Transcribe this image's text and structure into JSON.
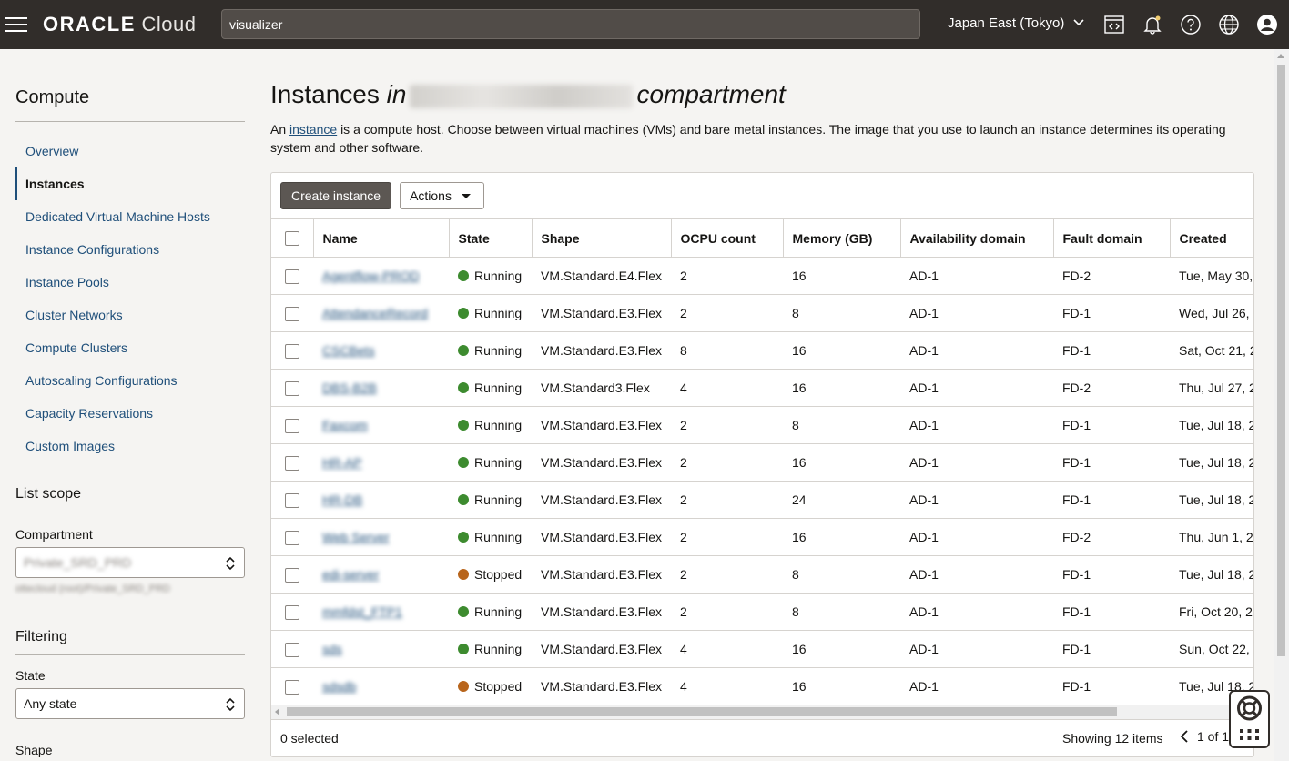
{
  "topbar": {
    "brand": "ORACLE",
    "product": "Cloud",
    "search_value": "visualizer",
    "region": "Japan East (Tokyo)",
    "icons": [
      "menu-icon",
      "code-editor-icon",
      "bell-icon",
      "help-icon",
      "globe-icon",
      "user-icon"
    ]
  },
  "sidebar": {
    "title": "Compute",
    "items": [
      {
        "label": "Overview",
        "active": false
      },
      {
        "label": "Instances",
        "active": true
      },
      {
        "label": "Dedicated Virtual Machine Hosts",
        "active": false
      },
      {
        "label": "Instance Configurations",
        "active": false
      },
      {
        "label": "Instance Pools",
        "active": false
      },
      {
        "label": "Cluster Networks",
        "active": false
      },
      {
        "label": "Compute Clusters",
        "active": false
      },
      {
        "label": "Autoscaling Configurations",
        "active": false
      },
      {
        "label": "Capacity Reservations",
        "active": false
      },
      {
        "label": "Custom Images",
        "active": false
      }
    ],
    "list_scope": {
      "title": "List scope",
      "compartment_label": "Compartment",
      "compartment_value": "Private_SRD_PRD",
      "compartment_path": "ottecloud (root)/Private_SRD_PRD"
    },
    "filtering": {
      "title": "Filtering",
      "state_label": "State",
      "state_value": "Any state",
      "shape_label": "Shape"
    }
  },
  "main": {
    "title": "Instances",
    "title_in": "in",
    "title_compartment": "compartment",
    "desc_prefix": "An",
    "desc_link": "instance",
    "desc_rest": "is a compute host. Choose between virtual machines (VMs) and bare metal instances. The image that you use to launch an instance determines its operating system and other software.",
    "create_button": "Create instance",
    "actions_button": "Actions",
    "columns": [
      "Name",
      "State",
      "Shape",
      "OCPU count",
      "Memory (GB)",
      "Availability domain",
      "Fault domain",
      "Created"
    ],
    "rows": [
      {
        "name": "Agentflow-PROD",
        "state": "Running",
        "shape": "VM.Standard.E4.Flex",
        "ocpu": "2",
        "memory": "16",
        "ad": "AD-1",
        "fd": "FD-2",
        "created": "Tue, May 30,"
      },
      {
        "name": "AttendanceRecord",
        "state": "Running",
        "shape": "VM.Standard.E3.Flex",
        "ocpu": "2",
        "memory": "8",
        "ad": "AD-1",
        "fd": "FD-1",
        "created": "Wed, Jul 26,"
      },
      {
        "name": "CSCBets",
        "state": "Running",
        "shape": "VM.Standard.E3.Flex",
        "ocpu": "8",
        "memory": "16",
        "ad": "AD-1",
        "fd": "FD-1",
        "created": "Sat, Oct 21, 2"
      },
      {
        "name": "DBS-B2B",
        "state": "Running",
        "shape": "VM.Standard3.Flex",
        "ocpu": "4",
        "memory": "16",
        "ad": "AD-1",
        "fd": "FD-2",
        "created": "Thu, Jul 27, 2"
      },
      {
        "name": "Faxcom",
        "state": "Running",
        "shape": "VM.Standard.E3.Flex",
        "ocpu": "2",
        "memory": "8",
        "ad": "AD-1",
        "fd": "FD-1",
        "created": "Tue, Jul 18, 2"
      },
      {
        "name": "HR-AP",
        "state": "Running",
        "shape": "VM.Standard.E3.Flex",
        "ocpu": "2",
        "memory": "16",
        "ad": "AD-1",
        "fd": "FD-1",
        "created": "Tue, Jul 18, 2"
      },
      {
        "name": "HR-DB",
        "state": "Running",
        "shape": "VM.Standard.E3.Flex",
        "ocpu": "2",
        "memory": "24",
        "ad": "AD-1",
        "fd": "FD-1",
        "created": "Tue, Jul 18, 2"
      },
      {
        "name": "Web Server",
        "state": "Running",
        "shape": "VM.Standard.E3.Flex",
        "ocpu": "2",
        "memory": "16",
        "ad": "AD-1",
        "fd": "FD-2",
        "created": "Thu, Jun 1, 2"
      },
      {
        "name": "edi-server",
        "state": "Stopped",
        "shape": "VM.Standard.E3.Flex",
        "ocpu": "2",
        "memory": "8",
        "ad": "AD-1",
        "fd": "FD-1",
        "created": "Tue, Jul 18, 2"
      },
      {
        "name": "mmfdst_FTP1",
        "state": "Running",
        "shape": "VM.Standard.E3.Flex",
        "ocpu": "2",
        "memory": "8",
        "ad": "AD-1",
        "fd": "FD-1",
        "created": "Fri, Oct 20, 20"
      },
      {
        "name": "sds",
        "state": "Running",
        "shape": "VM.Standard.E3.Flex",
        "ocpu": "4",
        "memory": "16",
        "ad": "AD-1",
        "fd": "FD-1",
        "created": "Sun, Oct 22,"
      },
      {
        "name": "sdsdb",
        "state": "Stopped",
        "shape": "VM.Standard.E3.Flex",
        "ocpu": "4",
        "memory": "16",
        "ad": "AD-1",
        "fd": "FD-1",
        "created": "Tue, Jul 18, 2"
      }
    ],
    "selected_text": "0 selected",
    "showing_text": "Showing 12 items",
    "page_text": "1 of 1"
  },
  "colors": {
    "running": "#3d8b2f",
    "stopped": "#b8651c",
    "link": "#1f4f7a",
    "topbar": "#312d2a"
  }
}
